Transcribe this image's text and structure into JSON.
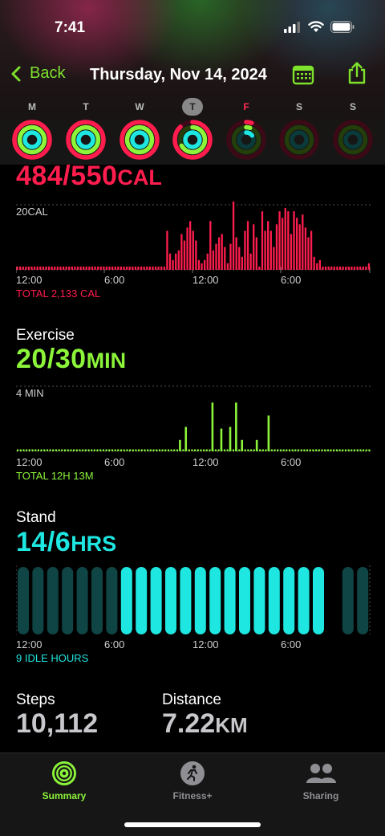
{
  "status": {
    "time": "7:41"
  },
  "nav": {
    "back_label": "Back",
    "title": "Thursday, Nov 14, 2024"
  },
  "days": [
    {
      "letter": "M",
      "move": 1.0,
      "exercise": 1.0,
      "stand": 1.0
    },
    {
      "letter": "T",
      "move": 1.0,
      "exercise": 1.0,
      "stand": 1.0
    },
    {
      "letter": "W",
      "move": 1.0,
      "exercise": 1.0,
      "stand": 1.0
    },
    {
      "letter": "T",
      "move": 0.88,
      "exercise": 0.67,
      "stand": 1.0,
      "today": true
    },
    {
      "letter": "F",
      "move": 0.05,
      "exercise": 0.05,
      "stand": 0.15,
      "accent": "#ff2d55"
    },
    {
      "letter": "S",
      "move": 0,
      "exercise": 0,
      "stand": 0
    },
    {
      "letter": "S",
      "move": 0,
      "exercise": 0,
      "stand": 0
    }
  ],
  "move": {
    "value": "484/550",
    "unit": "CAL",
    "scale_label": "20CAL",
    "ticks": [
      "12:00",
      "6:00",
      "12:00",
      "6:00"
    ],
    "total": "TOTAL 2,133 CAL",
    "color": "#ff1d4e"
  },
  "exercise": {
    "title": "Exercise",
    "value": "20/30",
    "unit": "MIN",
    "scale_label": "4 MIN",
    "ticks": [
      "12:00",
      "6:00",
      "12:00",
      "6:00"
    ],
    "total": "TOTAL 12H 13M",
    "color": "#8cf53a"
  },
  "stand": {
    "title": "Stand",
    "value": "14/6",
    "unit": "HRS",
    "ticks": [
      "12:00",
      "6:00",
      "12:00",
      "6:00"
    ],
    "total": "9 IDLE HOURS",
    "color": "#1ee6e0"
  },
  "stats": {
    "steps_label": "Steps",
    "steps_value": "10,112",
    "distance_label": "Distance",
    "distance_value": "7.22",
    "distance_unit": "KM"
  },
  "tabs": [
    {
      "label": "Summary",
      "icon": "activity-rings-icon",
      "active": true
    },
    {
      "label": "Fitness+",
      "icon": "runner-icon",
      "active": false
    },
    {
      "label": "Sharing",
      "icon": "people-icon",
      "active": false
    }
  ],
  "colors": {
    "accent": "#7ee12c",
    "move": "#ff1d4e",
    "exercise": "#8cf53a",
    "stand": "#1ee6e0"
  },
  "chart_data": [
    {
      "type": "bar",
      "title": "484/550CAL",
      "scale": "20CAL",
      "x": [
        "12:00",
        "6:00",
        "12:00",
        "6:00"
      ],
      "values": [
        1,
        1,
        1,
        1,
        1,
        1,
        1,
        1,
        1,
        1,
        1,
        1,
        1,
        1,
        1,
        1,
        1,
        1,
        1,
        1,
        1,
        1,
        1,
        1,
        1,
        1,
        1,
        1,
        1,
        1,
        1,
        1,
        1,
        1,
        1,
        1,
        1,
        1,
        1,
        1,
        1,
        1,
        1,
        1,
        1,
        1,
        1,
        1,
        1,
        1,
        1,
        1,
        12,
        5,
        3,
        5,
        6,
        11,
        9,
        13,
        15,
        12,
        9,
        3,
        2,
        3,
        5,
        15,
        6,
        8,
        10,
        11,
        7,
        2,
        8,
        21,
        10,
        7,
        4,
        12,
        15,
        5,
        14,
        10,
        1,
        18,
        12,
        15,
        12,
        7,
        14,
        18,
        16,
        19,
        18,
        11,
        18,
        16,
        14,
        17,
        13,
        10,
        12,
        4,
        2,
        3,
        1,
        1,
        1,
        1,
        1,
        1,
        1,
        1,
        1,
        1,
        1,
        1,
        1,
        1,
        1,
        1,
        2
      ],
      "ylim": [
        0,
        20
      ]
    },
    {
      "type": "bar",
      "title": "20/30MIN",
      "scale": "4 MIN",
      "x": [
        "12:00",
        "6:00",
        "12:00",
        "6:00"
      ],
      "values": [
        0.1,
        0.1,
        0.1,
        0.1,
        0.1,
        0.1,
        0.1,
        0.1,
        0.1,
        0.1,
        0.1,
        0.1,
        0.1,
        0.1,
        0.1,
        0.1,
        0.1,
        0.1,
        0.1,
        0.1,
        0.1,
        0.1,
        0.1,
        0.1,
        0.1,
        0.1,
        0.1,
        0.1,
        0.1,
        0.1,
        0.1,
        0.1,
        0.1,
        0.1,
        0.1,
        0.1,
        0.1,
        0.1,
        0.1,
        0.1,
        0.1,
        0.1,
        0.1,
        0.1,
        0.1,
        0.1,
        0.1,
        0.1,
        0.1,
        0.1,
        0.1,
        0.1,
        0.1,
        0.1,
        0.1,
        0.1,
        0.1,
        0.1,
        0.1,
        0.1,
        0.1,
        0.1,
        0.1,
        0.1,
        0.1,
        0.1,
        0.1,
        0.1,
        0.1,
        0.1,
        0.1,
        0.1,
        0.1,
        0.1,
        0.1,
        0.1,
        0.1,
        0.1,
        0.1,
        0.1,
        0.1,
        0.1,
        0.1,
        0.1,
        0.1,
        0.1,
        0.1,
        0.1,
        0.1,
        0.1,
        0.1,
        0.1,
        0.1,
        0.1,
        0.1,
        0.1,
        0.1,
        0.1,
        0.1,
        0.1,
        0.1,
        0.1,
        0.1,
        0.1,
        0.1,
        0.1,
        0.1,
        0.1,
        0.1,
        0.1,
        0.1,
        0.1,
        0.1,
        0.1,
        0.1,
        0.1,
        0.1,
        0.1,
        0.1,
        0.1
      ],
      "spikes": [
        [
          55,
          0.7
        ],
        [
          57,
          1.5
        ],
        [
          66,
          3.0
        ],
        [
          69,
          1.4
        ],
        [
          72,
          1.5
        ],
        [
          74,
          3.0
        ],
        [
          76,
          0.7
        ],
        [
          81,
          0.7
        ],
        [
          85,
          2.2
        ]
      ],
      "ylim": [
        0,
        4
      ]
    },
    {
      "type": "bar",
      "title": "14/6HRS",
      "x": [
        "12:00",
        "6:00",
        "12:00",
        "6:00"
      ],
      "hours_active": [
        0,
        0,
        0,
        0,
        0,
        0,
        0,
        1,
        1,
        1,
        1,
        1,
        1,
        1,
        1,
        1,
        1,
        1,
        1,
        1,
        1,
        0,
        0,
        0
      ],
      "total": "9 IDLE HOURS"
    }
  ]
}
